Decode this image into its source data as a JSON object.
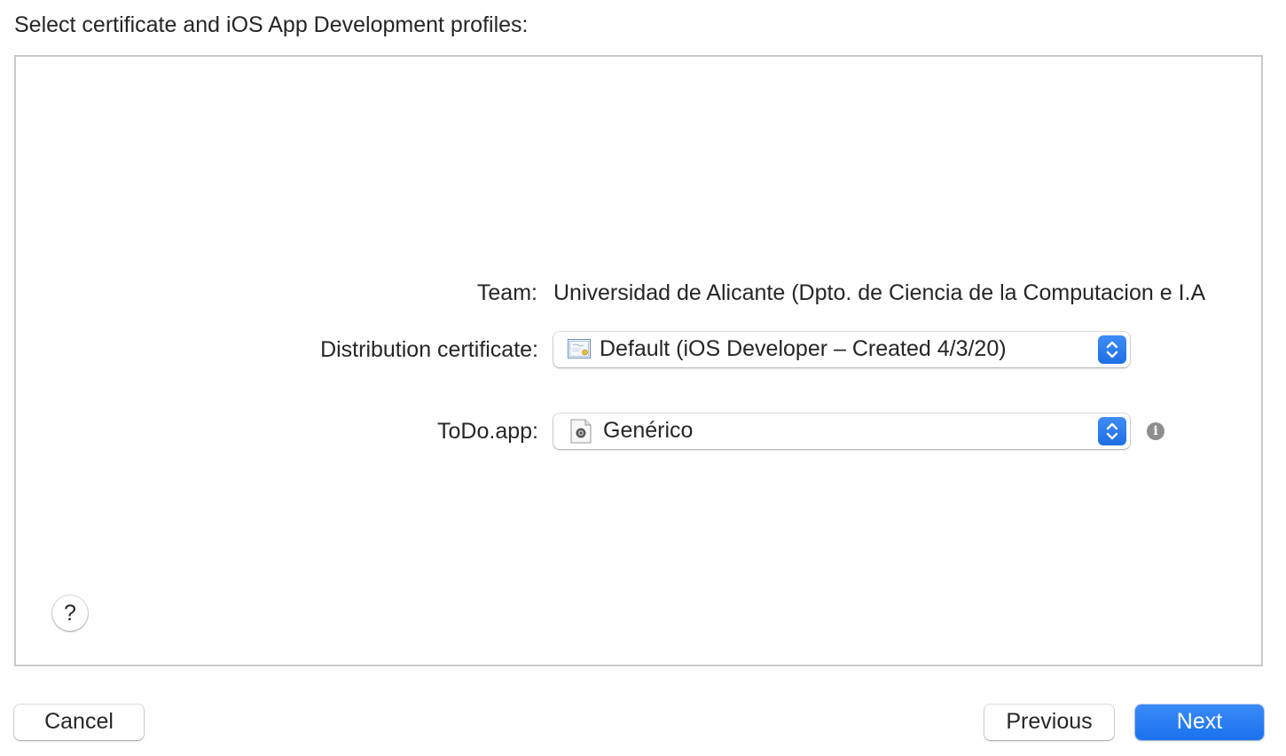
{
  "heading": "Select certificate and iOS App Development profiles:",
  "team": {
    "label": "Team:",
    "value": "Universidad de Alicante (Dpto. de Ciencia de la Computacion e I.A"
  },
  "distribution_certificate": {
    "label": "Distribution certificate:",
    "selected": "Default (iOS Developer – Created 4/3/20)",
    "icon": "certificate-icon"
  },
  "app_profile": {
    "label": "ToDo.app:",
    "selected": "Genérico",
    "icon": "profile-document-icon"
  },
  "info_icon": "i",
  "help_button": "?",
  "buttons": {
    "cancel": "Cancel",
    "previous": "Previous",
    "next": "Next"
  },
  "colors": {
    "accent": "#1f72ee",
    "info_icon": "#8e8e8e"
  }
}
